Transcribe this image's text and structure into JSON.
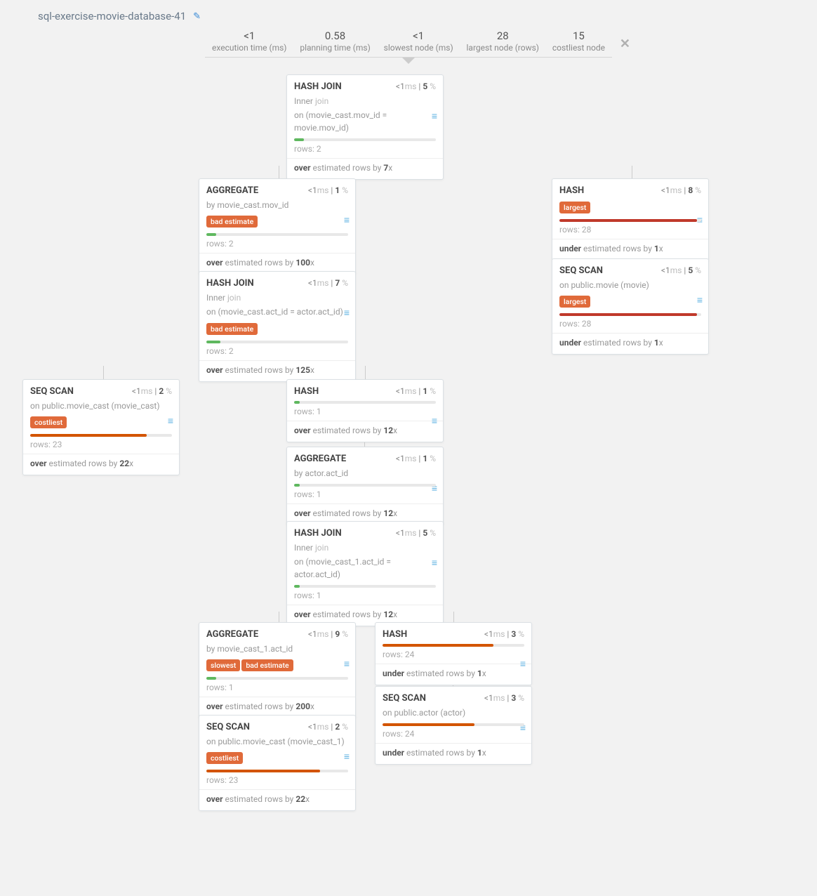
{
  "title": "sql-exercise-movie-database-41",
  "stats": {
    "exec_v": "<1",
    "exec_l": "execution time (ms)",
    "plan_v": "0.58",
    "plan_l": "planning time (ms)",
    "slow_v": "<1",
    "slow_l": "slowest node (ms)",
    "large_v": "28",
    "large_l": "largest node (rows)",
    "cost_v": "15",
    "cost_l": "costliest node"
  },
  "nodes": {
    "n1": {
      "title": "HASH JOIN",
      "ms": "<1",
      "pct": "5",
      "d1": "Inner",
      "d1a": "join",
      "d2": "on (movie_cast.mov_id = movie.mov_id)",
      "rows": "2",
      "fill": 7,
      "cls": "g",
      "est_pre": "over",
      "est_mid": "estimated rows by",
      "est_v": "7",
      "est_suf": "x"
    },
    "n2": {
      "title": "AGGREGATE",
      "ms": "<1",
      "pct": "1",
      "d1": "by movie_cast.mov_id",
      "tags": [
        "bad estimate"
      ],
      "rows": "2",
      "fill": 7,
      "cls": "g",
      "est_pre": "over",
      "est_mid": "estimated rows by",
      "est_v": "100",
      "est_suf": "x"
    },
    "n3": {
      "title": "HASH",
      "ms": "<1",
      "pct": "8",
      "tags": [
        "largest"
      ],
      "rows": "28",
      "fill": 97,
      "cls": "r",
      "est_pre": "under",
      "est_mid": "estimated rows by",
      "est_v": "1",
      "est_suf": "x"
    },
    "n4": {
      "title": "SEQ SCAN",
      "ms": "<1",
      "pct": "5",
      "d1": "on public.movie (movie)",
      "tags": [
        "largest"
      ],
      "rows": "28",
      "fill": 97,
      "cls": "r",
      "est_pre": "under",
      "est_mid": "estimated rows by",
      "est_v": "1",
      "est_suf": "x"
    },
    "n5": {
      "title": "HASH JOIN",
      "ms": "<1",
      "pct": "7",
      "d1": "Inner",
      "d1a": "join",
      "d2": "on (movie_cast.act_id = actor.act_id)",
      "tags": [
        "bad estimate"
      ],
      "rows": "2",
      "fill": 10,
      "cls": "g",
      "est_pre": "over",
      "est_mid": "estimated rows by",
      "est_v": "125",
      "est_suf": "x"
    },
    "n6": {
      "title": "SEQ SCAN",
      "ms": "<1",
      "pct": "2",
      "d1": "on public.movie_cast (movie_cast)",
      "tags": [
        "costliest"
      ],
      "rows": "23",
      "fill": 82,
      "cls": "o",
      "est_pre": "over",
      "est_mid": "estimated rows by",
      "est_v": "22",
      "est_suf": "x"
    },
    "n7": {
      "title": "HASH",
      "ms": "<1",
      "pct": "1",
      "rows": "1",
      "fill": 4,
      "cls": "g",
      "est_pre": "over",
      "est_mid": "estimated rows by",
      "est_v": "12",
      "est_suf": "x"
    },
    "n8": {
      "title": "AGGREGATE",
      "ms": "<1",
      "pct": "1",
      "d1": "by actor.act_id",
      "rows": "1",
      "fill": 4,
      "cls": "g",
      "est_pre": "over",
      "est_mid": "estimated rows by",
      "est_v": "12",
      "est_suf": "x"
    },
    "n9": {
      "title": "HASH JOIN",
      "ms": "<1",
      "pct": "5",
      "d1": "Inner",
      "d1a": "join",
      "d2": "on (movie_cast_1.act_id = actor.act_id)",
      "rows": "1",
      "fill": 4,
      "cls": "g",
      "est_pre": "over",
      "est_mid": "estimated rows by",
      "est_v": "12",
      "est_suf": "x"
    },
    "n10": {
      "title": "AGGREGATE",
      "ms": "<1",
      "pct": "9",
      "d1": "by movie_cast_1.act_id",
      "tags": [
        "slowest",
        "bad estimate"
      ],
      "rows": "1",
      "fill": 7,
      "cls": "g",
      "est_pre": "over",
      "est_mid": "estimated rows by",
      "est_v": "200",
      "est_suf": "x"
    },
    "n11": {
      "title": "HASH",
      "ms": "<1",
      "pct": "3",
      "rows": "24",
      "fill": 78,
      "cls": "o",
      "est_pre": "under",
      "est_mid": "estimated rows by",
      "est_v": "1",
      "est_suf": "x"
    },
    "n12": {
      "title": "SEQ SCAN",
      "ms": "<1",
      "pct": "3",
      "d1": "on public.actor (actor)",
      "rows": "24",
      "fill": 65,
      "cls": "o",
      "est_pre": "under",
      "est_mid": "estimated rows by",
      "est_v": "1",
      "est_suf": "x"
    },
    "n13": {
      "title": "SEQ SCAN",
      "ms": "<1",
      "pct": "2",
      "d1": "on public.movie_cast (movie_cast_1)",
      "tags": [
        "costliest"
      ],
      "rows": "23",
      "fill": 80,
      "cls": "o",
      "est_pre": "over",
      "est_mid": "estimated rows by",
      "est_v": "22",
      "est_suf": "x"
    }
  },
  "labels": {
    "ms": "ms",
    "pct": "%",
    "rows": "rows:"
  }
}
